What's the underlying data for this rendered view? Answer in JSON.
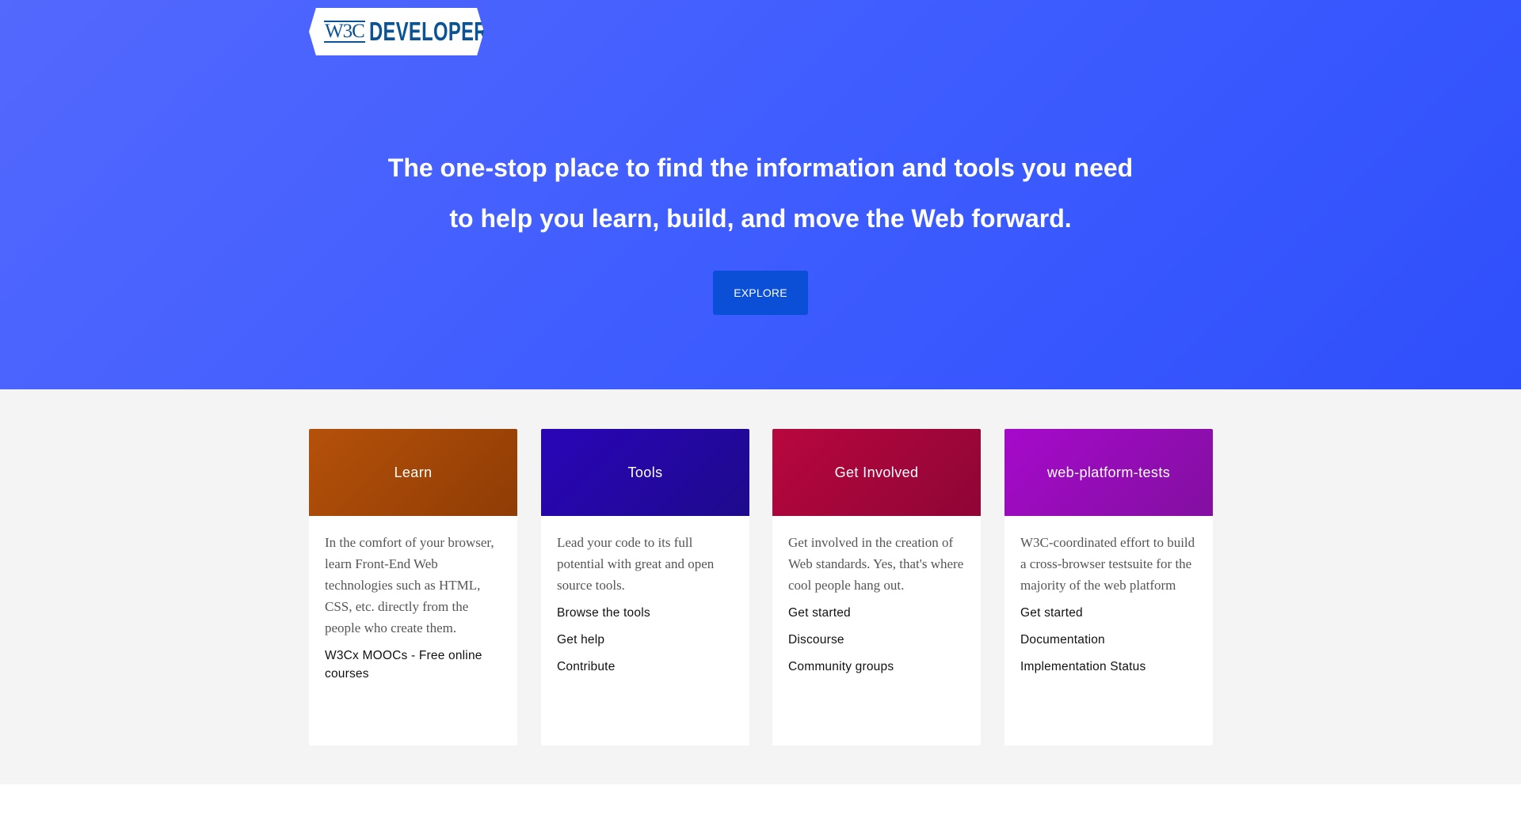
{
  "logo": {
    "w3c": "W3C",
    "developers": "DEVELOPERS"
  },
  "hero": {
    "line1": "The one-stop place to find the information and tools you need",
    "line2": "to help you learn, build, and move the Web forward.",
    "explore_label": "EXPLORE",
    "colors": {
      "gradient_start": "#5368fd",
      "gradient_end": "#2f4ffb",
      "button": "#0a4fd6"
    }
  },
  "cards": [
    {
      "title": "Learn",
      "description": "In the comfort of your browser, learn Front-End Web technologies such as HTML, CSS, etc. directly from the people who create them.",
      "links": [
        "W3Cx MOOCs - Free online courses"
      ],
      "colors": [
        "#b5510a",
        "#8f3c05"
      ]
    },
    {
      "title": "Tools",
      "description": "Lead your code to its full potential with great and open source tools.",
      "links": [
        "Browse the tools",
        "Get help",
        "Contribute"
      ],
      "colors": [
        "#2a05b8",
        "#1e0a8c"
      ]
    },
    {
      "title": "Get Involved",
      "description": "Get involved in the creation of Web standards. Yes, that's where cool people hang out.",
      "links": [
        "Get started",
        "Discourse",
        "Community groups"
      ],
      "colors": [
        "#b8073f",
        "#8e0535"
      ]
    },
    {
      "title": "web-platform-tests",
      "description": "W3C-coordinated effort to build a cross-browser testsuite for the majority of the web platform",
      "links": [
        "Get started",
        "Documentation",
        "Implementation Status"
      ],
      "colors": [
        "#a60acb",
        "#820fa0"
      ]
    }
  ]
}
